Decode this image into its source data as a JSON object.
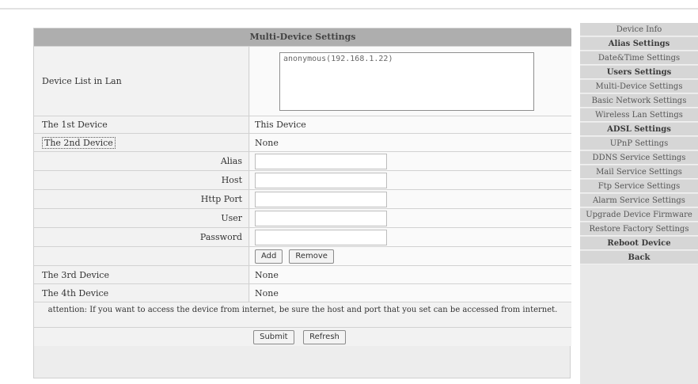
{
  "panel": {
    "title": "Multi-Device Settings",
    "device_list_label": "Device List in Lan",
    "device_list_value": "anonymous(192.168.1.22)",
    "first_device_label": "The 1st Device",
    "first_device_value": "This Device",
    "second_device_label": "The 2nd Device",
    "second_device_value": "None",
    "fields": {
      "alias_label": "Alias",
      "host_label": "Host",
      "http_port_label": "Http Port",
      "user_label": "User",
      "password_label": "Password"
    },
    "add_button": "Add",
    "remove_button": "Remove",
    "third_device_label": "The 3rd Device",
    "third_device_value": "None",
    "fourth_device_label": "The 4th Device",
    "fourth_device_value": "None",
    "notice": "attention: If you want to access the device from internet, be sure the host and port that you set can be accessed from internet.",
    "submit_button": "Submit",
    "refresh_button": "Refresh"
  },
  "menu": {
    "items": [
      "Device Info",
      "Alias Settings",
      "Date&Time Settings",
      "Users Settings",
      "Multi-Device Settings",
      "Basic Network Settings",
      "Wireless Lan Settings",
      "ADSL Settings",
      "UPnP Settings",
      "DDNS Service Settings",
      "Mail Service Settings",
      "Ftp Service Settings",
      "Alarm Service Settings",
      "Upgrade Device Firmware",
      "Restore Factory Settings",
      "Reboot Device",
      "Back"
    ]
  }
}
